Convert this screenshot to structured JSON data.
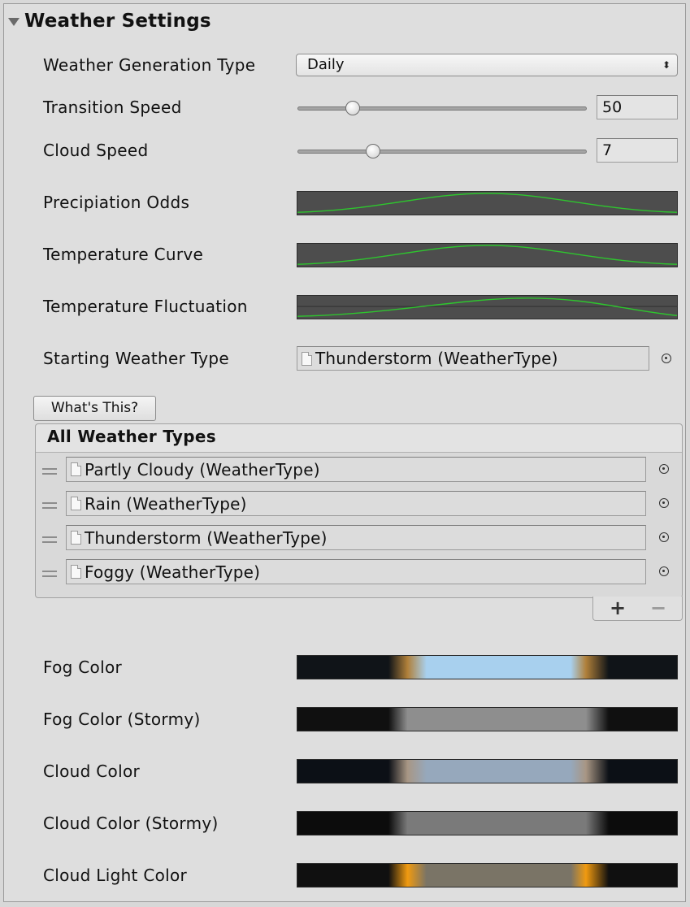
{
  "section": {
    "title": "Weather Settings"
  },
  "fields": {
    "weather_generation_type": {
      "label": "Weather Generation Type",
      "value": "Daily"
    },
    "transition_speed": {
      "label": "Transition Speed",
      "value": "50",
      "slider_fraction": 0.19
    },
    "cloud_speed": {
      "label": "Cloud Speed",
      "value": "7",
      "slider_fraction": 0.26
    },
    "precipitation_odds": {
      "label": "Precipiation Odds"
    },
    "temperature_curve": {
      "label": "Temperature Curve"
    },
    "temperature_fluctuation": {
      "label": "Temperature Fluctuation"
    },
    "starting_weather_type": {
      "label": "Starting Weather Type",
      "value": "Thunderstorm (WeatherType)"
    }
  },
  "whats_this_button": "What's This?",
  "weather_list": {
    "title": "All Weather Types",
    "items": [
      "Partly Cloudy (WeatherType)",
      "Rain (WeatherType)",
      "Thunderstorm (WeatherType)",
      "Foggy (WeatherType)"
    ],
    "add_label": "+",
    "remove_label": "−"
  },
  "colors": {
    "fog_color": {
      "label": "Fog Color",
      "center": "#a8d0ee",
      "edge": "#b0803a",
      "outer": "#101418"
    },
    "fog_color_stormy": {
      "label": "Fog Color (Stormy)",
      "center": "#8e8e8e",
      "edge": "#8e8e8e",
      "outer": "#101010"
    },
    "cloud_color": {
      "label": "Cloud Color",
      "center": "#96a8bc",
      "edge": "#a89684",
      "outer": "#0c1016"
    },
    "cloud_color_stormy": {
      "label": "Cloud Color (Stormy)",
      "center": "#7a7a7a",
      "edge": "#7a7a7a",
      "outer": "#0c0c0c"
    },
    "cloud_light_color": {
      "label": "Cloud Light Color",
      "center": "#7a7466",
      "edge": "#f09a10",
      "outer": "#101010"
    }
  },
  "curve_color": "#2ec52e"
}
